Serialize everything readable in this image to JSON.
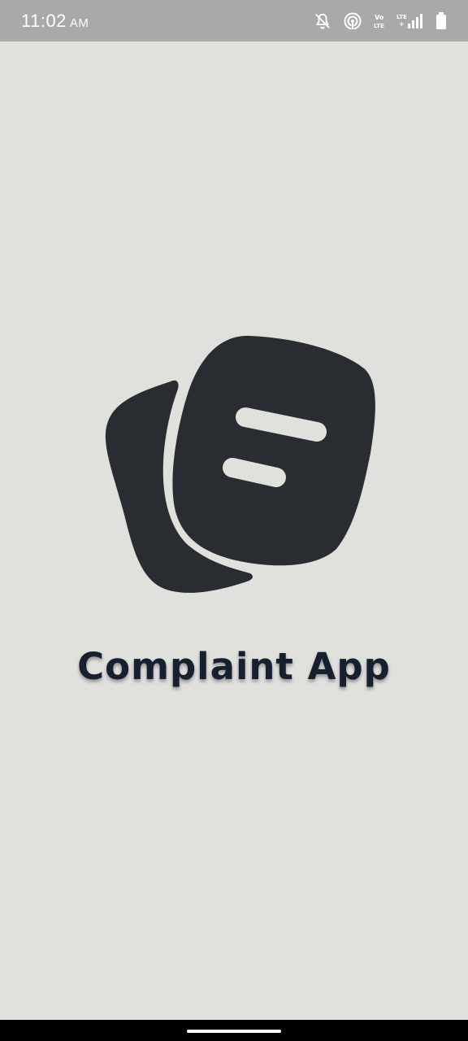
{
  "status_bar": {
    "time": "11:02",
    "ampm": "AM",
    "net_label_top": "Vo",
    "net_label_bottom": "LTE",
    "lte_top": "LTE",
    "lte_bottom": "+",
    "background": "#a9a9a7",
    "icons": [
      "notifications-off-icon",
      "hotspot-icon",
      "volte-icon",
      "lte-signal-icon",
      "battery-icon"
    ]
  },
  "splash": {
    "title": "Complaint App",
    "logo_icon": "chat-bubbles-icon"
  },
  "colors": {
    "background": "#e0e0dd",
    "logo": "#292d32",
    "title": "#17202e",
    "nav_bar": "#000000",
    "home_indicator": "#ffffff"
  }
}
